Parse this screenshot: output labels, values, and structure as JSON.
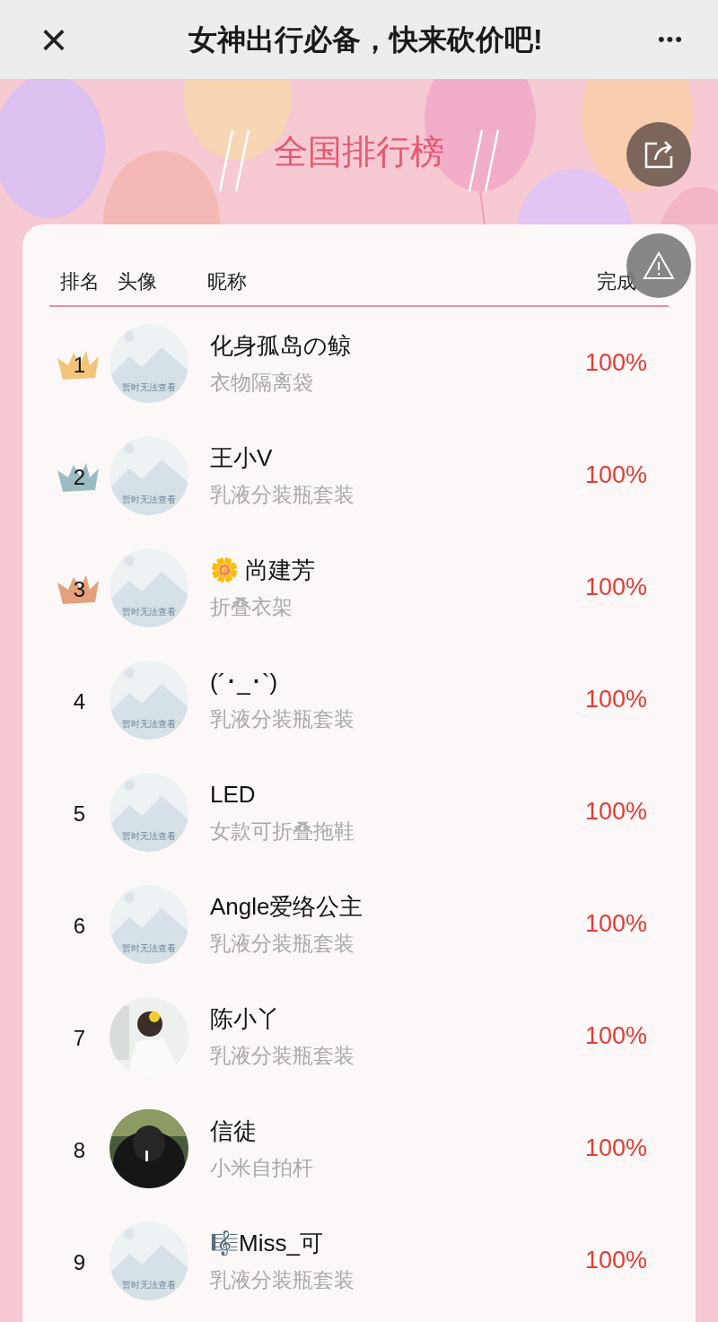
{
  "nav": {
    "close": "×",
    "title": "女神出行必备，快来砍价吧!",
    "more": "•••"
  },
  "banner": {
    "title": "全国排行榜"
  },
  "table": {
    "columns": [
      "排名",
      "头像",
      "昵称",
      "完成"
    ],
    "rows": [
      {
        "rank": "1",
        "medal": true,
        "color": "#f3c57a",
        "avatar": {
          "kind": "placeholder",
          "caption": "暂时无法查看"
        },
        "name": "化身孤岛の鲸",
        "item": "衣物隔离袋",
        "progress": "100%"
      },
      {
        "rank": "2",
        "medal": true,
        "color": "#9bbcc2",
        "avatar": {
          "kind": "placeholder",
          "caption": "暂时无法查看"
        },
        "name": "王小V",
        "item": "乳液分装瓶套装",
        "progress": "100%"
      },
      {
        "rank": "3",
        "medal": true,
        "color": "#e3a07a",
        "avatar": {
          "kind": "placeholder",
          "caption": "暂时无法查看"
        },
        "name": "🌼 尚建芳",
        "item": "折叠衣架",
        "progress": "100%"
      },
      {
        "rank": "4",
        "medal": false,
        "avatar": {
          "kind": "placeholder",
          "caption": "暂时无法查看"
        },
        "name": "(´･_･`)",
        "item": "乳液分装瓶套装",
        "progress": "100%"
      },
      {
        "rank": "5",
        "medal": false,
        "avatar": {
          "kind": "placeholder",
          "caption": "暂时无法查看"
        },
        "name": "LED",
        "item": "女款可折叠拖鞋",
        "progress": "100%"
      },
      {
        "rank": "6",
        "medal": false,
        "avatar": {
          "kind": "placeholder",
          "caption": "暂时无法查看"
        },
        "name": "Angle爱络公主",
        "item": "乳液分装瓶套装",
        "progress": "100%"
      },
      {
        "rank": "7",
        "medal": false,
        "name": "陈小丫",
        "item": "乳液分装瓶套装",
        "progress": "100%"
      },
      {
        "rank": "8",
        "medal": false,
        "name": "信徒",
        "item": "小米自拍杆",
        "progress": "100%"
      },
      {
        "rank": "9",
        "medal": false,
        "avatar": {
          "kind": "placeholder",
          "caption": "暂时无法查看"
        },
        "name": "🎼Miss_可",
        "item": "乳液分装瓶套装",
        "progress": "100%"
      }
    ]
  }
}
